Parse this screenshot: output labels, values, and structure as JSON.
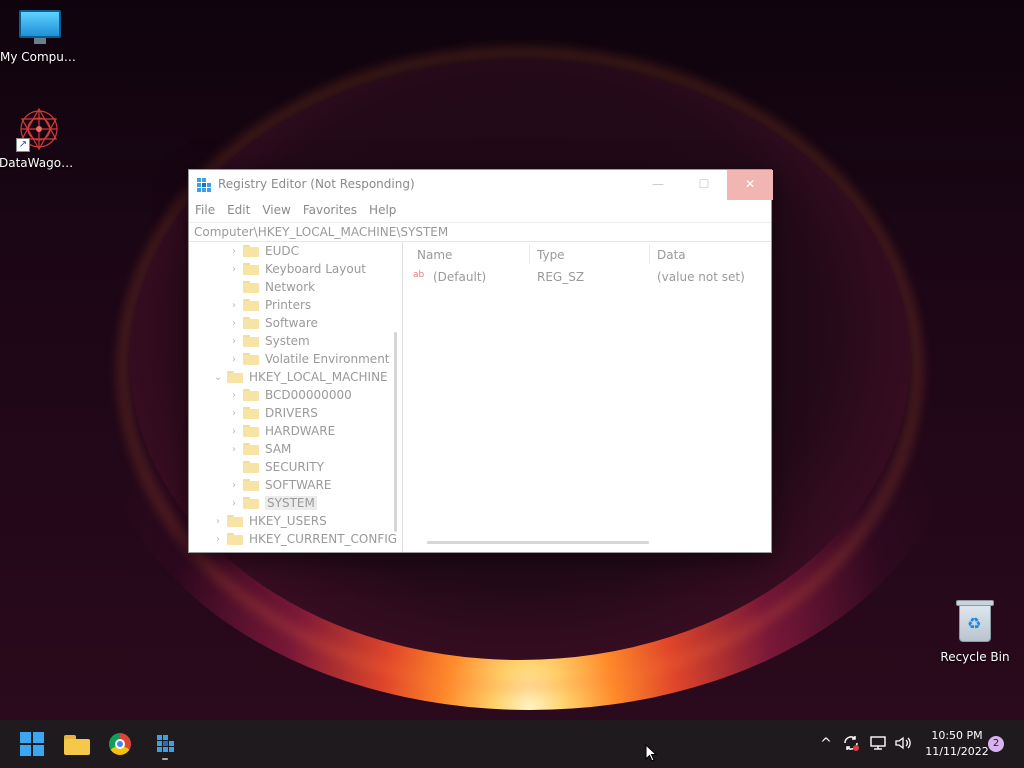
{
  "desktop": {
    "icons": [
      {
        "label": "My Computer",
        "icon": "monitor-icon"
      },
      {
        "label": "DataWagon...",
        "icon": "mandala-icon"
      },
      {
        "label": "Recycle Bin",
        "icon": "recycle-bin-icon"
      }
    ]
  },
  "window": {
    "title": "Registry Editor (Not Responding)",
    "controls": {
      "minimize": "—",
      "maximize": "☐",
      "close": "✕"
    },
    "menu": [
      "File",
      "Edit",
      "View",
      "Favorites",
      "Help"
    ],
    "address": "Computer\\HKEY_LOCAL_MACHINE\\SYSTEM",
    "tree": [
      {
        "label": "EUDC",
        "chevron": "›"
      },
      {
        "label": "Keyboard Layout",
        "chevron": "›"
      },
      {
        "label": "Network",
        "chevron": ""
      },
      {
        "label": "Printers",
        "chevron": "›"
      },
      {
        "label": "Software",
        "chevron": "›"
      },
      {
        "label": "System",
        "chevron": "›"
      },
      {
        "label": "Volatile Environment",
        "chevron": "›"
      },
      {
        "label": "HKEY_LOCAL_MACHINE",
        "chevron": "⌄"
      },
      {
        "label": "BCD00000000",
        "chevron": "›"
      },
      {
        "label": "DRIVERS",
        "chevron": "›"
      },
      {
        "label": "HARDWARE",
        "chevron": "›"
      },
      {
        "label": "SAM",
        "chevron": "›"
      },
      {
        "label": "SECURITY",
        "chevron": ""
      },
      {
        "label": "SOFTWARE",
        "chevron": "›"
      },
      {
        "label": "SYSTEM",
        "chevron": "›",
        "selected": true
      },
      {
        "label": "HKEY_USERS",
        "chevron": "›"
      },
      {
        "label": "HKEY_CURRENT_CONFIG",
        "chevron": "›"
      }
    ],
    "columns": [
      "Name",
      "Type",
      "Data"
    ],
    "rows": [
      {
        "name": "(Default)",
        "type": "REG_SZ",
        "data": "(value not set)",
        "icon": "ab"
      }
    ]
  },
  "taskbar": {
    "apps": [
      "start-button",
      "file-explorer",
      "chrome",
      "registry-editor"
    ],
    "tray": {
      "chevron": "^",
      "time": "10:50 PM",
      "date": "11/11/2022",
      "notifications": "2"
    }
  }
}
